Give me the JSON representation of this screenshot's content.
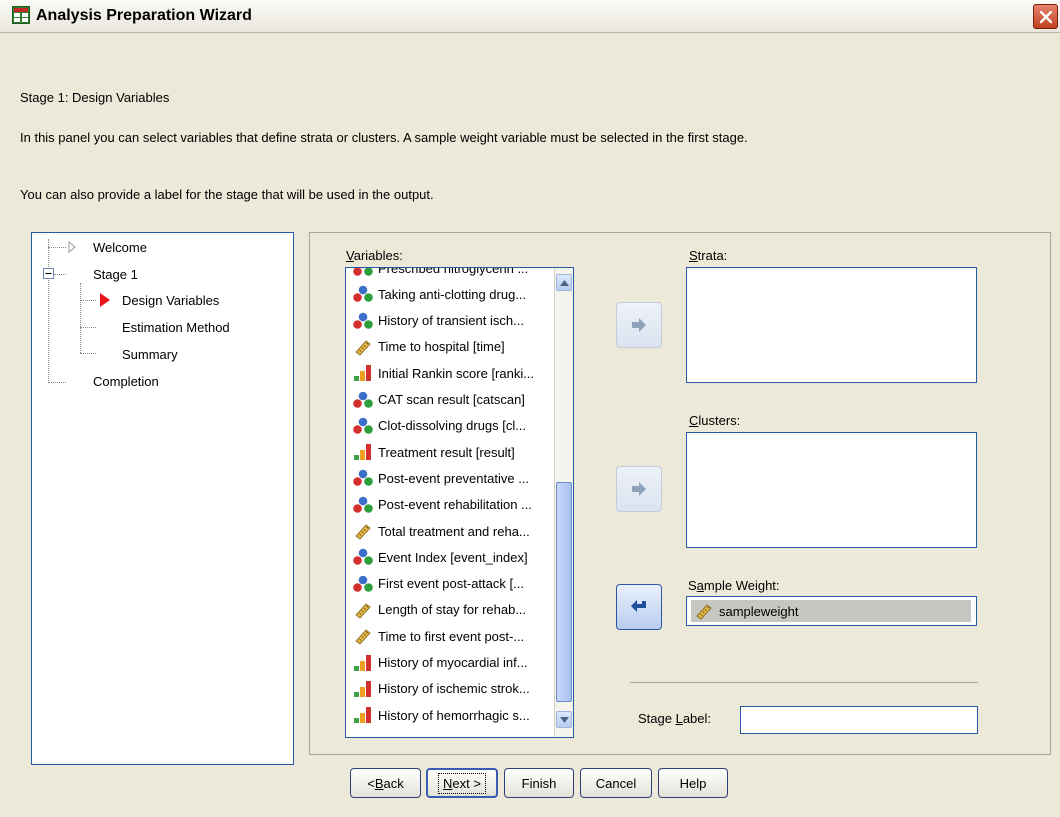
{
  "window": {
    "title": "Analysis Preparation Wizard",
    "close_icon": "close-x-icon",
    "app_icon": "spreadsheet-grid-icon"
  },
  "stage_heading": "Stage 1: Design Variables",
  "description": "In this panel you can select variables that define strata or clusters. A sample weight variable must be selected in the first stage.",
  "note": "You can also provide a label for the stage that will be used in the output.",
  "nav": {
    "welcome": "Welcome",
    "stage1": "Stage 1",
    "design_variables": "Design Variables",
    "estimation_method": "Estimation Method",
    "summary": "Summary",
    "completion": "Completion"
  },
  "variables": {
    "label_pre": "",
    "label_accel": "V",
    "label_post": "ariables:",
    "items": [
      {
        "label": "Prescribed nitroglycerin ...",
        "type": "nominal"
      },
      {
        "label": "Taking anti-clotting drug...",
        "type": "nominal"
      },
      {
        "label": "History of transient isch...",
        "type": "nominal"
      },
      {
        "label": "Time to hospital [time]",
        "type": "scale"
      },
      {
        "label": "Initial Rankin score [ranki...",
        "type": "ordinal"
      },
      {
        "label": "CAT scan result [catscan]",
        "type": "nominal"
      },
      {
        "label": "Clot-dissolving drugs [cl...",
        "type": "nominal"
      },
      {
        "label": "Treatment result [result]",
        "type": "ordinal"
      },
      {
        "label": "Post-event preventative ...",
        "type": "nominal"
      },
      {
        "label": "Post-event rehabilitation ...",
        "type": "nominal"
      },
      {
        "label": "Total treatment and reha...",
        "type": "scale"
      },
      {
        "label": "Event Index [event_index]",
        "type": "nominal"
      },
      {
        "label": "First event post-attack [...",
        "type": "nominal"
      },
      {
        "label": "Length of stay for rehab...",
        "type": "scale"
      },
      {
        "label": "Time to first event post-...",
        "type": "scale"
      },
      {
        "label": "History of myocardial inf...",
        "type": "ordinal"
      },
      {
        "label": "History of ischemic strok...",
        "type": "ordinal"
      },
      {
        "label": "History of hemorrhagic s...",
        "type": "ordinal"
      }
    ]
  },
  "strata": {
    "label_pre": "",
    "label_accel": "S",
    "label_post": "trata:"
  },
  "clusters": {
    "label_pre": "",
    "label_accel": "C",
    "label_post": "lusters:"
  },
  "sample_weight": {
    "label_pre": "S",
    "label_accel": "a",
    "label_post": "mple Weight:",
    "value": "sampleweight"
  },
  "stage_label": {
    "label_pre": "Stage ",
    "label_accel": "L",
    "label_post": "abel:",
    "value": ""
  },
  "buttons": {
    "back_pre": "< ",
    "back_accel": "B",
    "back_post": "ack",
    "next_pre": "",
    "next_accel": "N",
    "next_post": "ext >",
    "finish": "Finish",
    "cancel": "Cancel",
    "help": "Help"
  },
  "colors": {
    "accent_border": "#2659a8",
    "selected_item_bg": "#c8c6c0",
    "current_step_marker": "#e8141b"
  },
  "icons": {
    "nominal": "nominal-measure-icon",
    "ordinal": "ordinal-measure-icon",
    "scale": "scale-measure-icon",
    "move_right": "arrow-right-icon",
    "move_left": "arrow-left-icon"
  }
}
